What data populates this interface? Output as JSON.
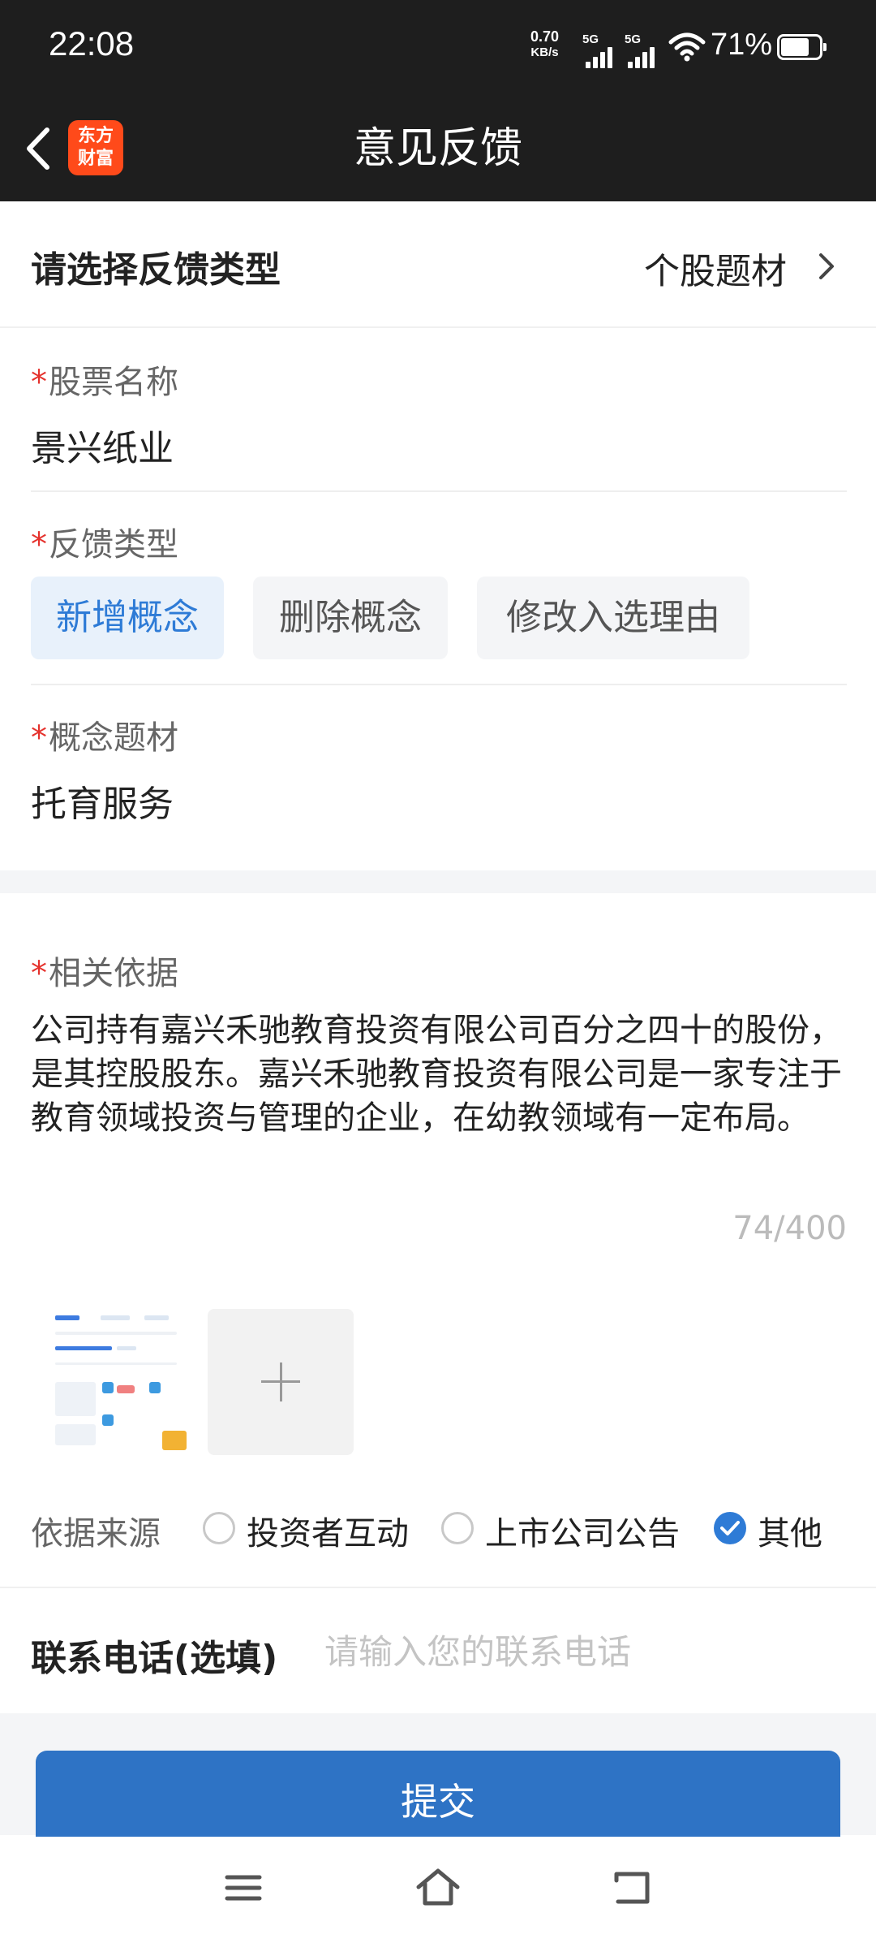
{
  "status_bar": {
    "time": "22:08",
    "net_speed_value": "0.70",
    "net_speed_unit": "KB/s",
    "sim1": "5G",
    "sim2": "5G",
    "battery_pct": "71%"
  },
  "nav": {
    "title": "意见反馈",
    "logo_line1": "东方",
    "logo_line2": "财富",
    "logo_color": "#ff4a1a"
  },
  "feedback_type": {
    "label": "请选择反馈类型",
    "value": "个股题材"
  },
  "stock": {
    "label": "股票名称",
    "value": "景兴纸业"
  },
  "fb_kind": {
    "label": "反馈类型",
    "options": [
      "新增概念",
      "删除概念",
      "修改入选理由"
    ],
    "selected": "新增概念"
  },
  "concept": {
    "label": "概念题材",
    "value": "托育服务"
  },
  "basis": {
    "label": "相关依据",
    "text": "公司持有嘉兴禾驰教育投资有限公司百分之四十的股份，是其控股股东。嘉兴禾驰教育投资有限公司是一家专注于教育领域投资与管理的企业，在幼教领域有一定布局。",
    "counter": "74/400"
  },
  "source": {
    "label": "依据来源",
    "options": [
      "投资者互动",
      "上市公司公告",
      "其他"
    ],
    "selected": "其他"
  },
  "phone": {
    "label": "联系电话(选填)",
    "placeholder": "请输入您的联系电话",
    "value": ""
  },
  "submit_label": "提交",
  "colors": {
    "accent": "#2e7bd6",
    "submit": "#2e73c5",
    "required_star": "#e5322d",
    "header_bg": "#1e1e1e"
  }
}
